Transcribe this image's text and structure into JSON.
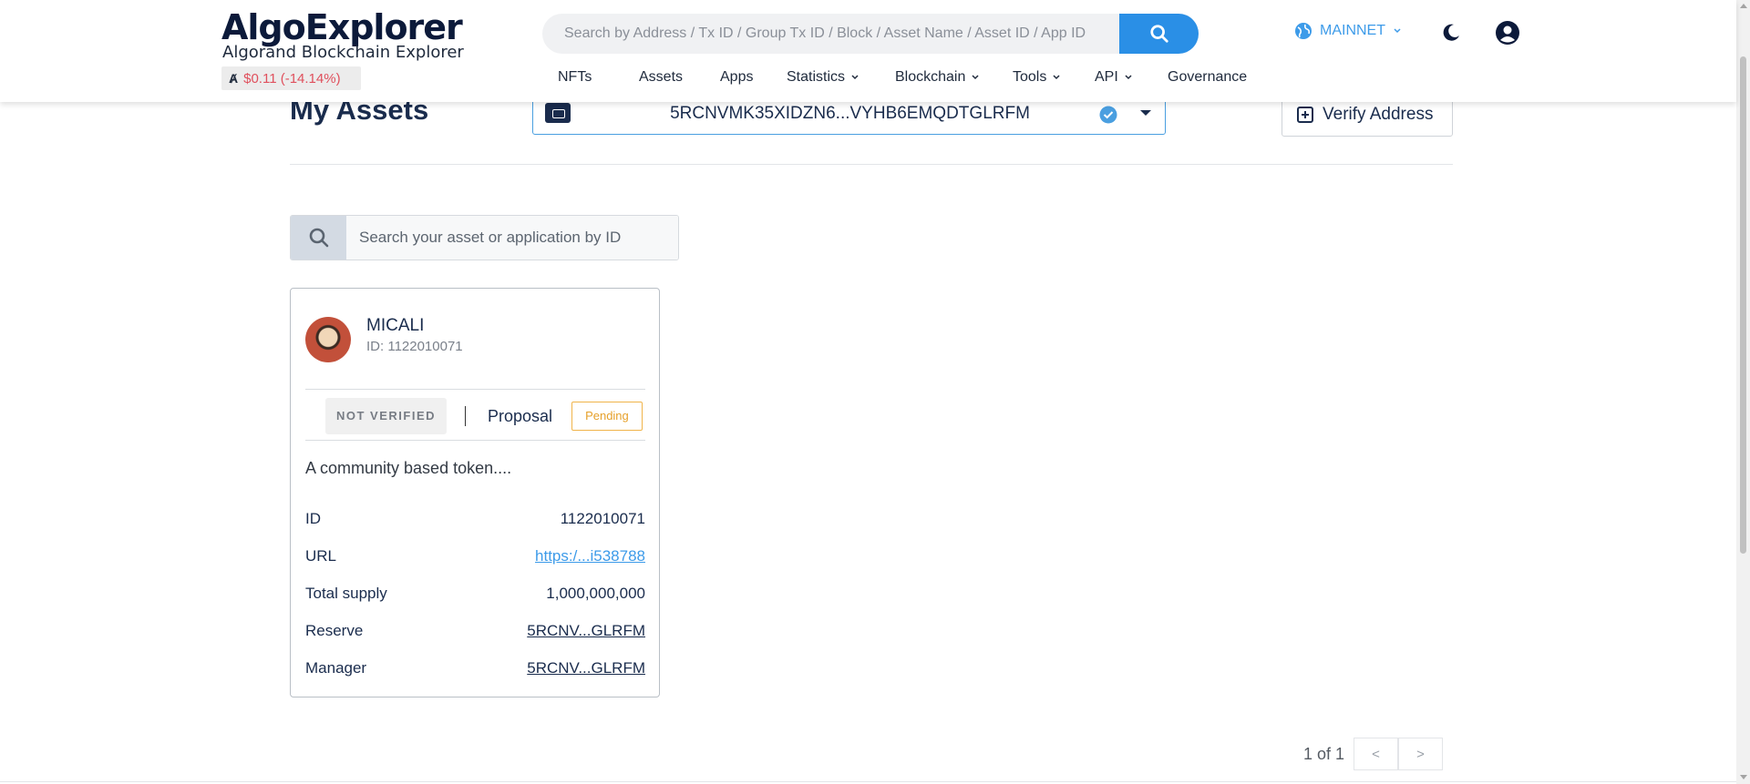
{
  "header": {
    "logo_text": "AlgoExplorer",
    "tagline": "Algorand Blockchain Explorer",
    "price": "$0.11 (-14.14%)",
    "search_placeholder": "Search by Address / Tx ID / Group Tx ID / Block / Asset Name / Asset ID / App ID",
    "network": "MAINNET",
    "nav": [
      {
        "label": "NFTs",
        "dropdown": false
      },
      {
        "label": "Assets",
        "dropdown": false
      },
      {
        "label": "Apps",
        "dropdown": false
      },
      {
        "label": "Statistics",
        "dropdown": true
      },
      {
        "label": "Blockchain",
        "dropdown": true
      },
      {
        "label": "Tools",
        "dropdown": true
      },
      {
        "label": "API",
        "dropdown": true
      },
      {
        "label": "Governance",
        "dropdown": false
      }
    ]
  },
  "main": {
    "title": "My Assets",
    "selected_address": "5RCNVMK35XIDZN6...VYHB6EMQDTGLRFM",
    "verify_label": "Verify Address",
    "asset_search_placeholder": "Search your asset or application by ID"
  },
  "asset_card": {
    "name": "MICALI",
    "id_line": "ID: 1122010071",
    "verification": "NOT VERIFIED",
    "proposal_label": "Proposal",
    "proposal_status": "Pending",
    "description": "A community based token....",
    "rows": [
      {
        "label": "ID",
        "value": "1122010071",
        "kind": "text"
      },
      {
        "label": "URL",
        "value": "https:/...i538788",
        "kind": "link"
      },
      {
        "label": "Total supply",
        "value": "1,000,000,000",
        "kind": "text"
      },
      {
        "label": "Reserve",
        "value": "5RCNV...GLRFM",
        "kind": "addr"
      },
      {
        "label": "Manager",
        "value": "5RCNV...GLRFM",
        "kind": "addr"
      }
    ]
  },
  "pagination": {
    "text": "1 of 1",
    "prev": "<",
    "next": ">"
  },
  "colors": {
    "accent": "#2a8fe6",
    "price_down": "#e0505d",
    "pending": "#e6a02a"
  }
}
